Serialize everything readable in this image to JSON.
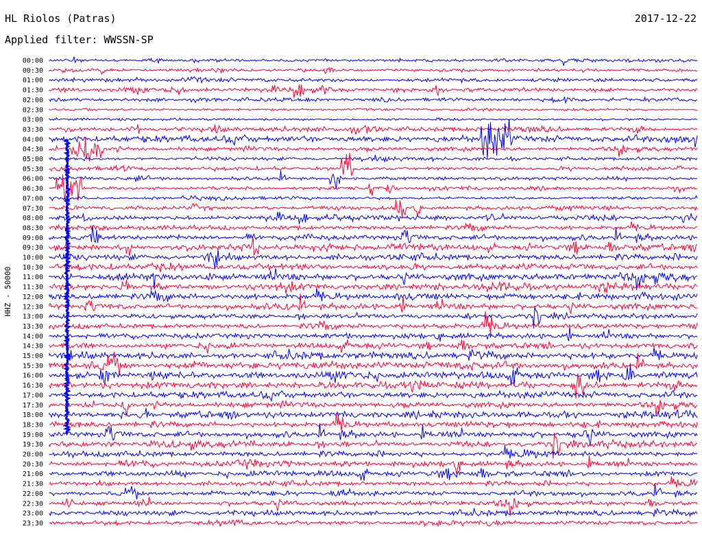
{
  "header": {
    "station": "HL Riolos (Patras)",
    "date": "2017-12-22",
    "filter": "Applied filter: WWSSN-SP",
    "channel": "HHZ - 50000"
  },
  "chart_data": {
    "type": "line",
    "title": "HL Riolos (Patras)",
    "subtitle": "Applied filter: WWSSN-SP",
    "date": "2017-12-22",
    "ylabel": "HHZ - 50000",
    "trace_colors": [
      "#0000ff",
      "#ff0033"
    ],
    "grid": false,
    "rows": [
      {
        "time": "00:00",
        "activity": 0.3
      },
      {
        "time": "00:30",
        "activity": 0.35
      },
      {
        "time": "01:00",
        "activity": 0.4
      },
      {
        "time": "01:30",
        "activity": 0.45
      },
      {
        "time": "02:00",
        "activity": 0.45
      },
      {
        "time": "02:30",
        "activity": 0.15
      },
      {
        "time": "03:00",
        "activity": 0.1
      },
      {
        "time": "03:30",
        "activity": 0.6
      },
      {
        "time": "04:00",
        "activity": 0.9
      },
      {
        "time": "04:30",
        "activity": 0.55
      },
      {
        "time": "05:00",
        "activity": 0.35
      },
      {
        "time": "05:30",
        "activity": 0.4
      },
      {
        "time": "06:00",
        "activity": 0.35
      },
      {
        "time": "06:30",
        "activity": 0.3
      },
      {
        "time": "07:00",
        "activity": 0.3
      },
      {
        "time": "07:30",
        "activity": 0.45
      },
      {
        "time": "08:00",
        "activity": 0.55
      },
      {
        "time": "08:30",
        "activity": 0.6
      },
      {
        "time": "09:00",
        "activity": 0.75
      },
      {
        "time": "09:30",
        "activity": 0.85
      },
      {
        "time": "10:00",
        "activity": 0.85
      },
      {
        "time": "10:30",
        "activity": 0.9
      },
      {
        "time": "11:00",
        "activity": 0.95
      },
      {
        "time": "11:30",
        "activity": 0.9
      },
      {
        "time": "12:00",
        "activity": 0.95
      },
      {
        "time": "12:30",
        "activity": 0.85
      },
      {
        "time": "13:00",
        "activity": 0.7
      },
      {
        "time": "13:30",
        "activity": 0.65
      },
      {
        "time": "14:00",
        "activity": 0.7
      },
      {
        "time": "14:30",
        "activity": 0.8
      },
      {
        "time": "15:00",
        "activity": 0.95
      },
      {
        "time": "15:30",
        "activity": 0.95
      },
      {
        "time": "16:00",
        "activity": 1.0
      },
      {
        "time": "16:30",
        "activity": 0.95
      },
      {
        "time": "17:00",
        "activity": 0.9
      },
      {
        "time": "17:30",
        "activity": 0.85
      },
      {
        "time": "18:00",
        "activity": 0.9
      },
      {
        "time": "18:30",
        "activity": 0.85
      },
      {
        "time": "19:00",
        "activity": 0.85
      },
      {
        "time": "19:30",
        "activity": 0.8
      },
      {
        "time": "20:00",
        "activity": 0.75
      },
      {
        "time": "20:30",
        "activity": 0.7
      },
      {
        "time": "21:00",
        "activity": 0.75
      },
      {
        "time": "21:30",
        "activity": 0.6
      },
      {
        "time": "22:00",
        "activity": 0.65
      },
      {
        "time": "22:30",
        "activity": 0.55
      },
      {
        "time": "23:00",
        "activity": 0.6
      },
      {
        "time": "23:30",
        "activity": 0.55
      }
    ],
    "events": [
      {
        "time": "04:30",
        "offset_minutes": 1,
        "duration_minutes": 1.5,
        "amplitude": 2.2
      },
      {
        "time": "06:00",
        "offset_minutes": 13,
        "duration_minutes": 0.5,
        "amplitude": 2.0
      },
      {
        "time": "05:30",
        "offset_minutes": 13.5,
        "duration_minutes": 0.6,
        "amplitude": 2.6
      },
      {
        "time": "04:00",
        "offset_minutes": 20,
        "duration_minutes": 1.5,
        "amplitude": 3.2
      },
      {
        "time": "06:30",
        "offset_minutes": 0.3,
        "duration_minutes": 1.2,
        "amplitude": 3.0
      }
    ]
  }
}
